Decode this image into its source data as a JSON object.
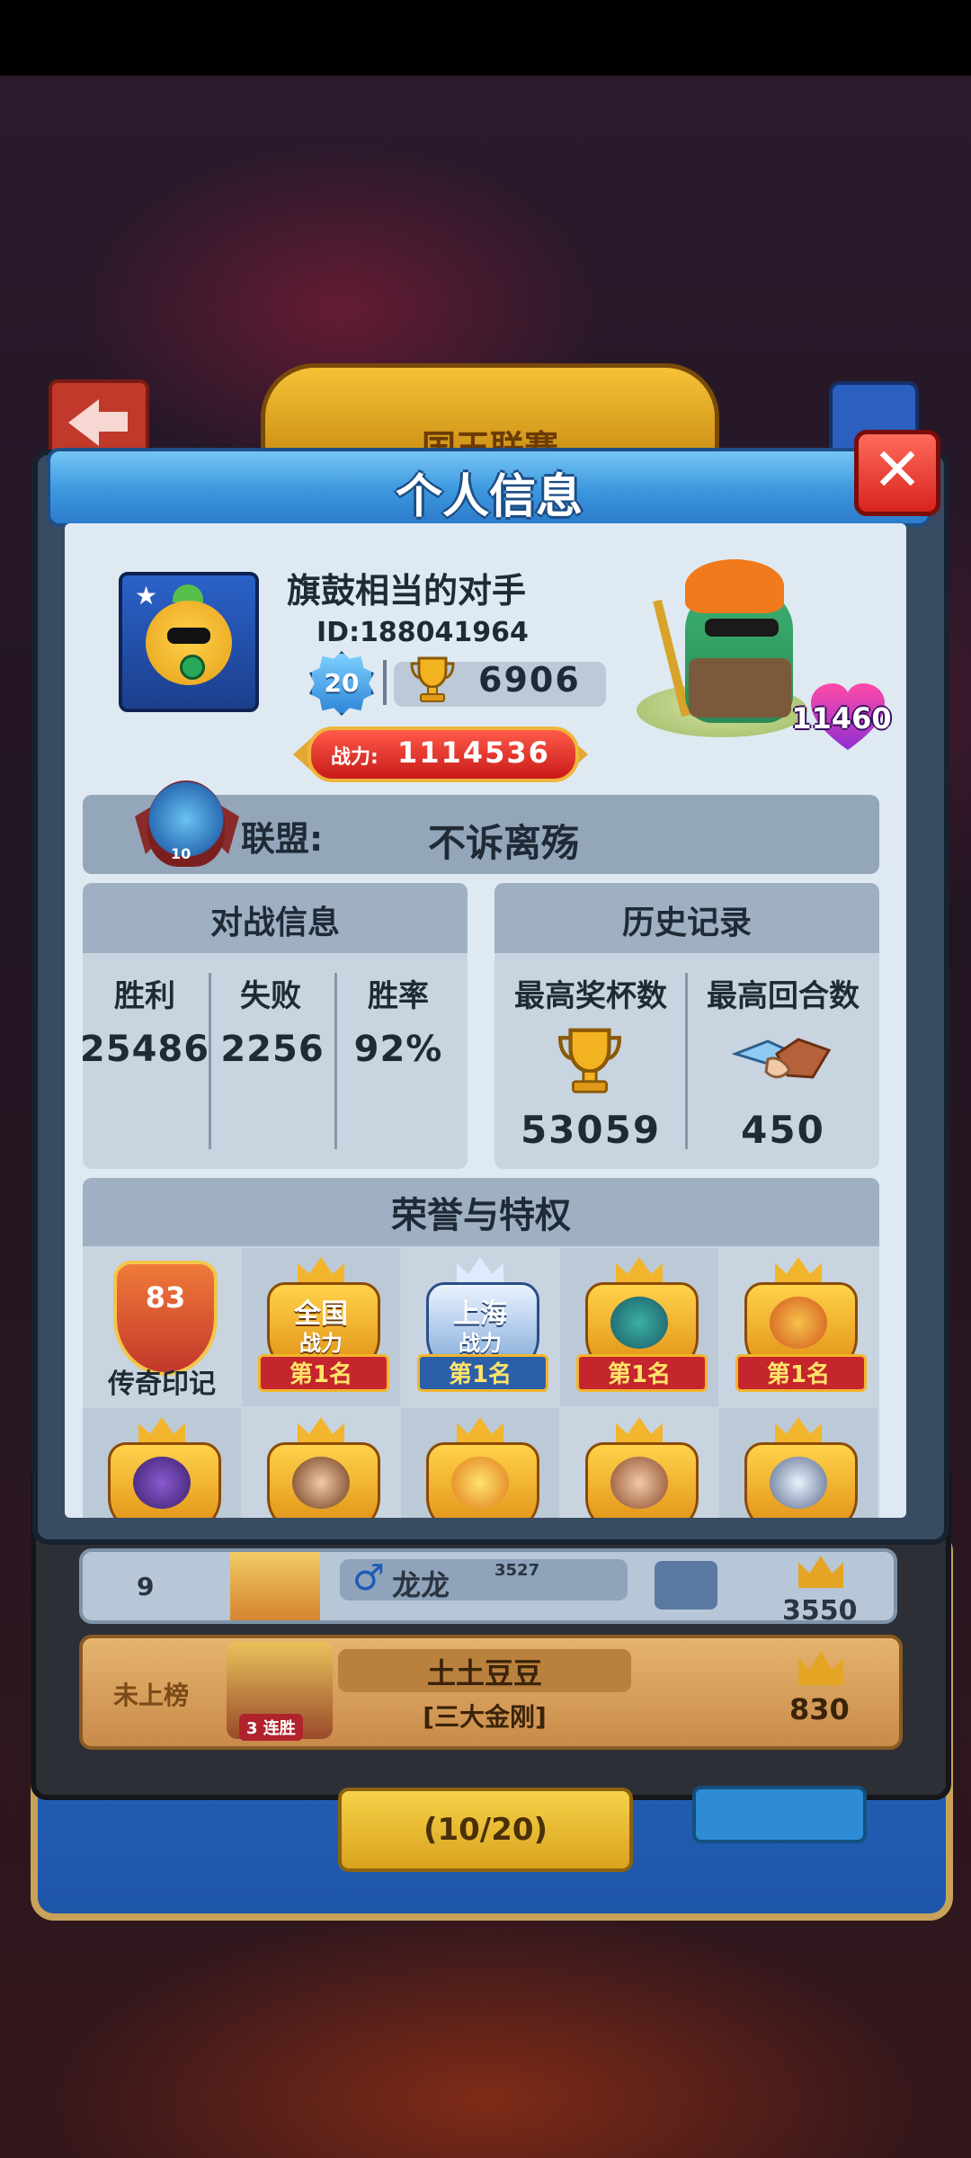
{
  "dialog": {
    "title": "个人信息",
    "close_icon": "close-icon"
  },
  "profile": {
    "name": "旗鼓相当的对手",
    "id_text": "ID:188041964",
    "level": "20",
    "trophies": "6906",
    "power_label": "战力:",
    "power_value": "1114536",
    "hero_hp": "11460"
  },
  "alliance": {
    "label": "联盟:",
    "name": "不诉离殇",
    "level": "10"
  },
  "battle_info": {
    "title": "对战信息",
    "columns": [
      "胜利",
      "失败",
      "胜率"
    ],
    "values": [
      "25486",
      "2256",
      "92%"
    ]
  },
  "history": {
    "title": "历史记录",
    "columns": [
      "最高奖杯数",
      "最高回合数"
    ],
    "values": [
      "53059",
      "450"
    ]
  },
  "honors": {
    "title": "荣誉与特权",
    "legend_mark_number": "83",
    "legend_mark_caption": "传奇印记",
    "badges": [
      {
        "top": "全国",
        "mid": "战力",
        "rank": "第1名"
      },
      {
        "top": "上海",
        "mid": "战力",
        "rank": "第1名"
      },
      {
        "rank": "第1名"
      },
      {
        "rank": "第1名"
      }
    ]
  },
  "background": {
    "crown_banner": "国王联赛",
    "row1": {
      "rank": "9",
      "name": "龙龙",
      "sup": "3527",
      "score": "3550"
    },
    "row2": {
      "status": "未上榜",
      "name": "土土豆豆",
      "guild": "[三大金刚]",
      "streak": "3 连胜",
      "score": "830"
    },
    "match_button": "(10/20)",
    "male_symbol": "♂"
  },
  "colors": {
    "header_blue": "#3c97de",
    "close_red": "#d8231e",
    "content_bg": "#dfe9f2",
    "panel_head": "#9fb0c2"
  }
}
